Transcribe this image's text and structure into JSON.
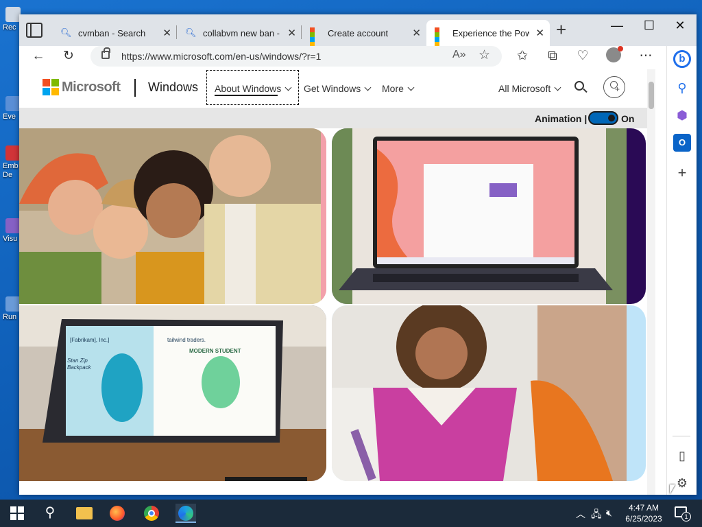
{
  "desktop": {
    "icons": [
      {
        "label": "Rec"
      },
      {
        "label": "Eve"
      },
      {
        "label": "Emb De"
      },
      {
        "label": "Visu"
      },
      {
        "label": "Run"
      }
    ]
  },
  "browser": {
    "tabs": [
      {
        "label": "cvmban - Search",
        "icon": "search-icon"
      },
      {
        "label": "collabvm new ban - Se",
        "icon": "search-icon"
      },
      {
        "label": "Create account",
        "icon": "microsoft-logo-icon"
      },
      {
        "label": "Experience the Power",
        "icon": "microsoft-logo-icon",
        "active": true
      }
    ],
    "url": "https://www.microsoft.com/en-us/windows/?r=1",
    "window_controls": {
      "minimize": "—",
      "maximize": "☐",
      "close": "✕"
    }
  },
  "site": {
    "brand": "Microsoft",
    "product": "Windows",
    "nav": [
      "About Windows",
      "Get Windows",
      "More"
    ],
    "all_microsoft": "All Microsoft",
    "animation_label": "Animation |",
    "animation_state": "On",
    "animation_on": true,
    "gallery": [
      "people-laughing-around-laptop",
      "windows-11-laptop-on-desk",
      "two-in-one-tablet-shopping-apps",
      "woman-smiling-with-stylus"
    ],
    "tablet_text": {
      "store_left": "[Fabrikam], Inc.]",
      "product_left": "Stan Zip Backpack",
      "store_right": "tailwind traders.",
      "product_right": "MODERN STUDENT"
    }
  },
  "taskbar": {
    "time": "4:47 AM",
    "date": "6/25/2023",
    "notification_count": "1",
    "apps": [
      "start",
      "search",
      "file-explorer",
      "firefox",
      "chrome",
      "edge"
    ]
  },
  "colors": {
    "ms_red": "#f25022",
    "ms_green": "#7fba00",
    "ms_blue": "#00a4ef",
    "ms_yellow": "#ffb900",
    "toggle_blue": "#0067b8"
  }
}
